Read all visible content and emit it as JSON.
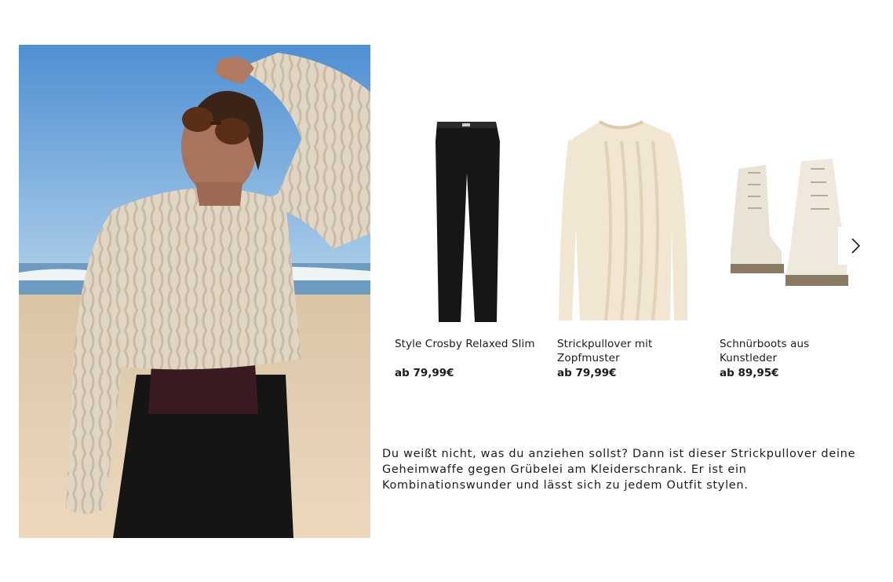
{
  "hero": {
    "alt_name": "model-photo"
  },
  "products": [
    {
      "name": "Style Crosby Relaxed Slim",
      "price": "ab 79,99€"
    },
    {
      "name": "Strickpullover mit Zopfmuster",
      "price": "ab 79,99€"
    },
    {
      "name": "Schnürboots aus Kunstleder",
      "price": "ab 89,95€"
    }
  ],
  "carousel": {
    "next_icon": "chevron-right-icon"
  },
  "description": "Du weißt nicht, was du anziehen sollst? Dann ist dieser Strickpullover deine Geheimwaffe gegen Grübelei am Kleiderschrank. Er ist ein Kombinationswunder und lässt sich zu jedem Outfit stylen.",
  "colors": {
    "text": "#1b1b1b",
    "sweater": "#e7dccb",
    "sky": "#7fb2de",
    "sand": "#e2cdb1"
  }
}
